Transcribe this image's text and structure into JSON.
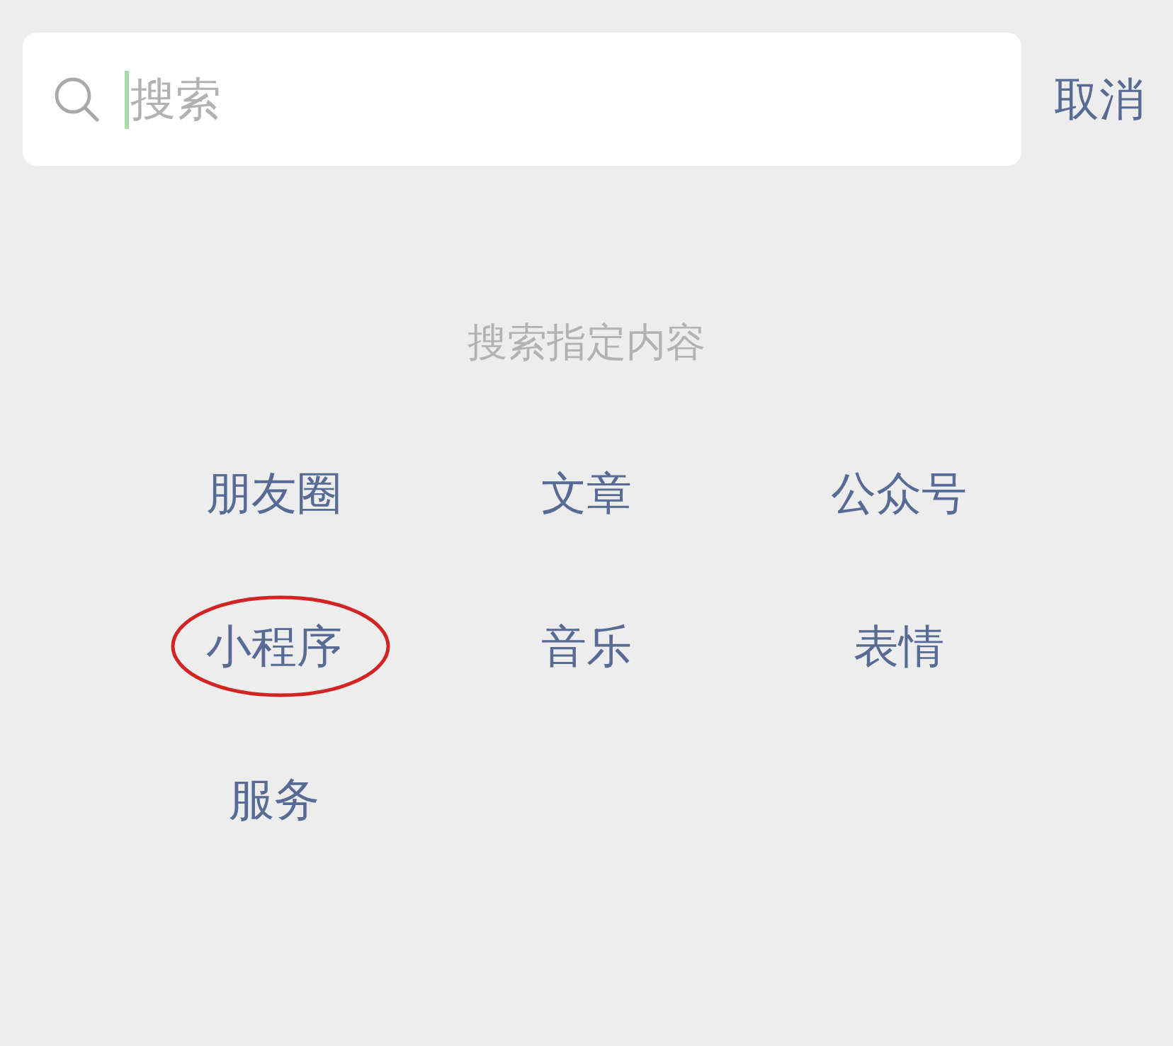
{
  "search_bar": {
    "placeholder": "搜索",
    "focused": true,
    "cancel_label": "取消"
  },
  "section_title": "搜索指定内容",
  "categories": [
    {
      "label": "朋友圈",
      "circled": false
    },
    {
      "label": "文章",
      "circled": false
    },
    {
      "label": "公众号",
      "circled": false
    },
    {
      "label": "小程序",
      "circled": true
    },
    {
      "label": "音乐",
      "circled": false
    },
    {
      "label": "表情",
      "circled": false
    },
    {
      "label": "服务",
      "circled": false
    }
  ]
}
